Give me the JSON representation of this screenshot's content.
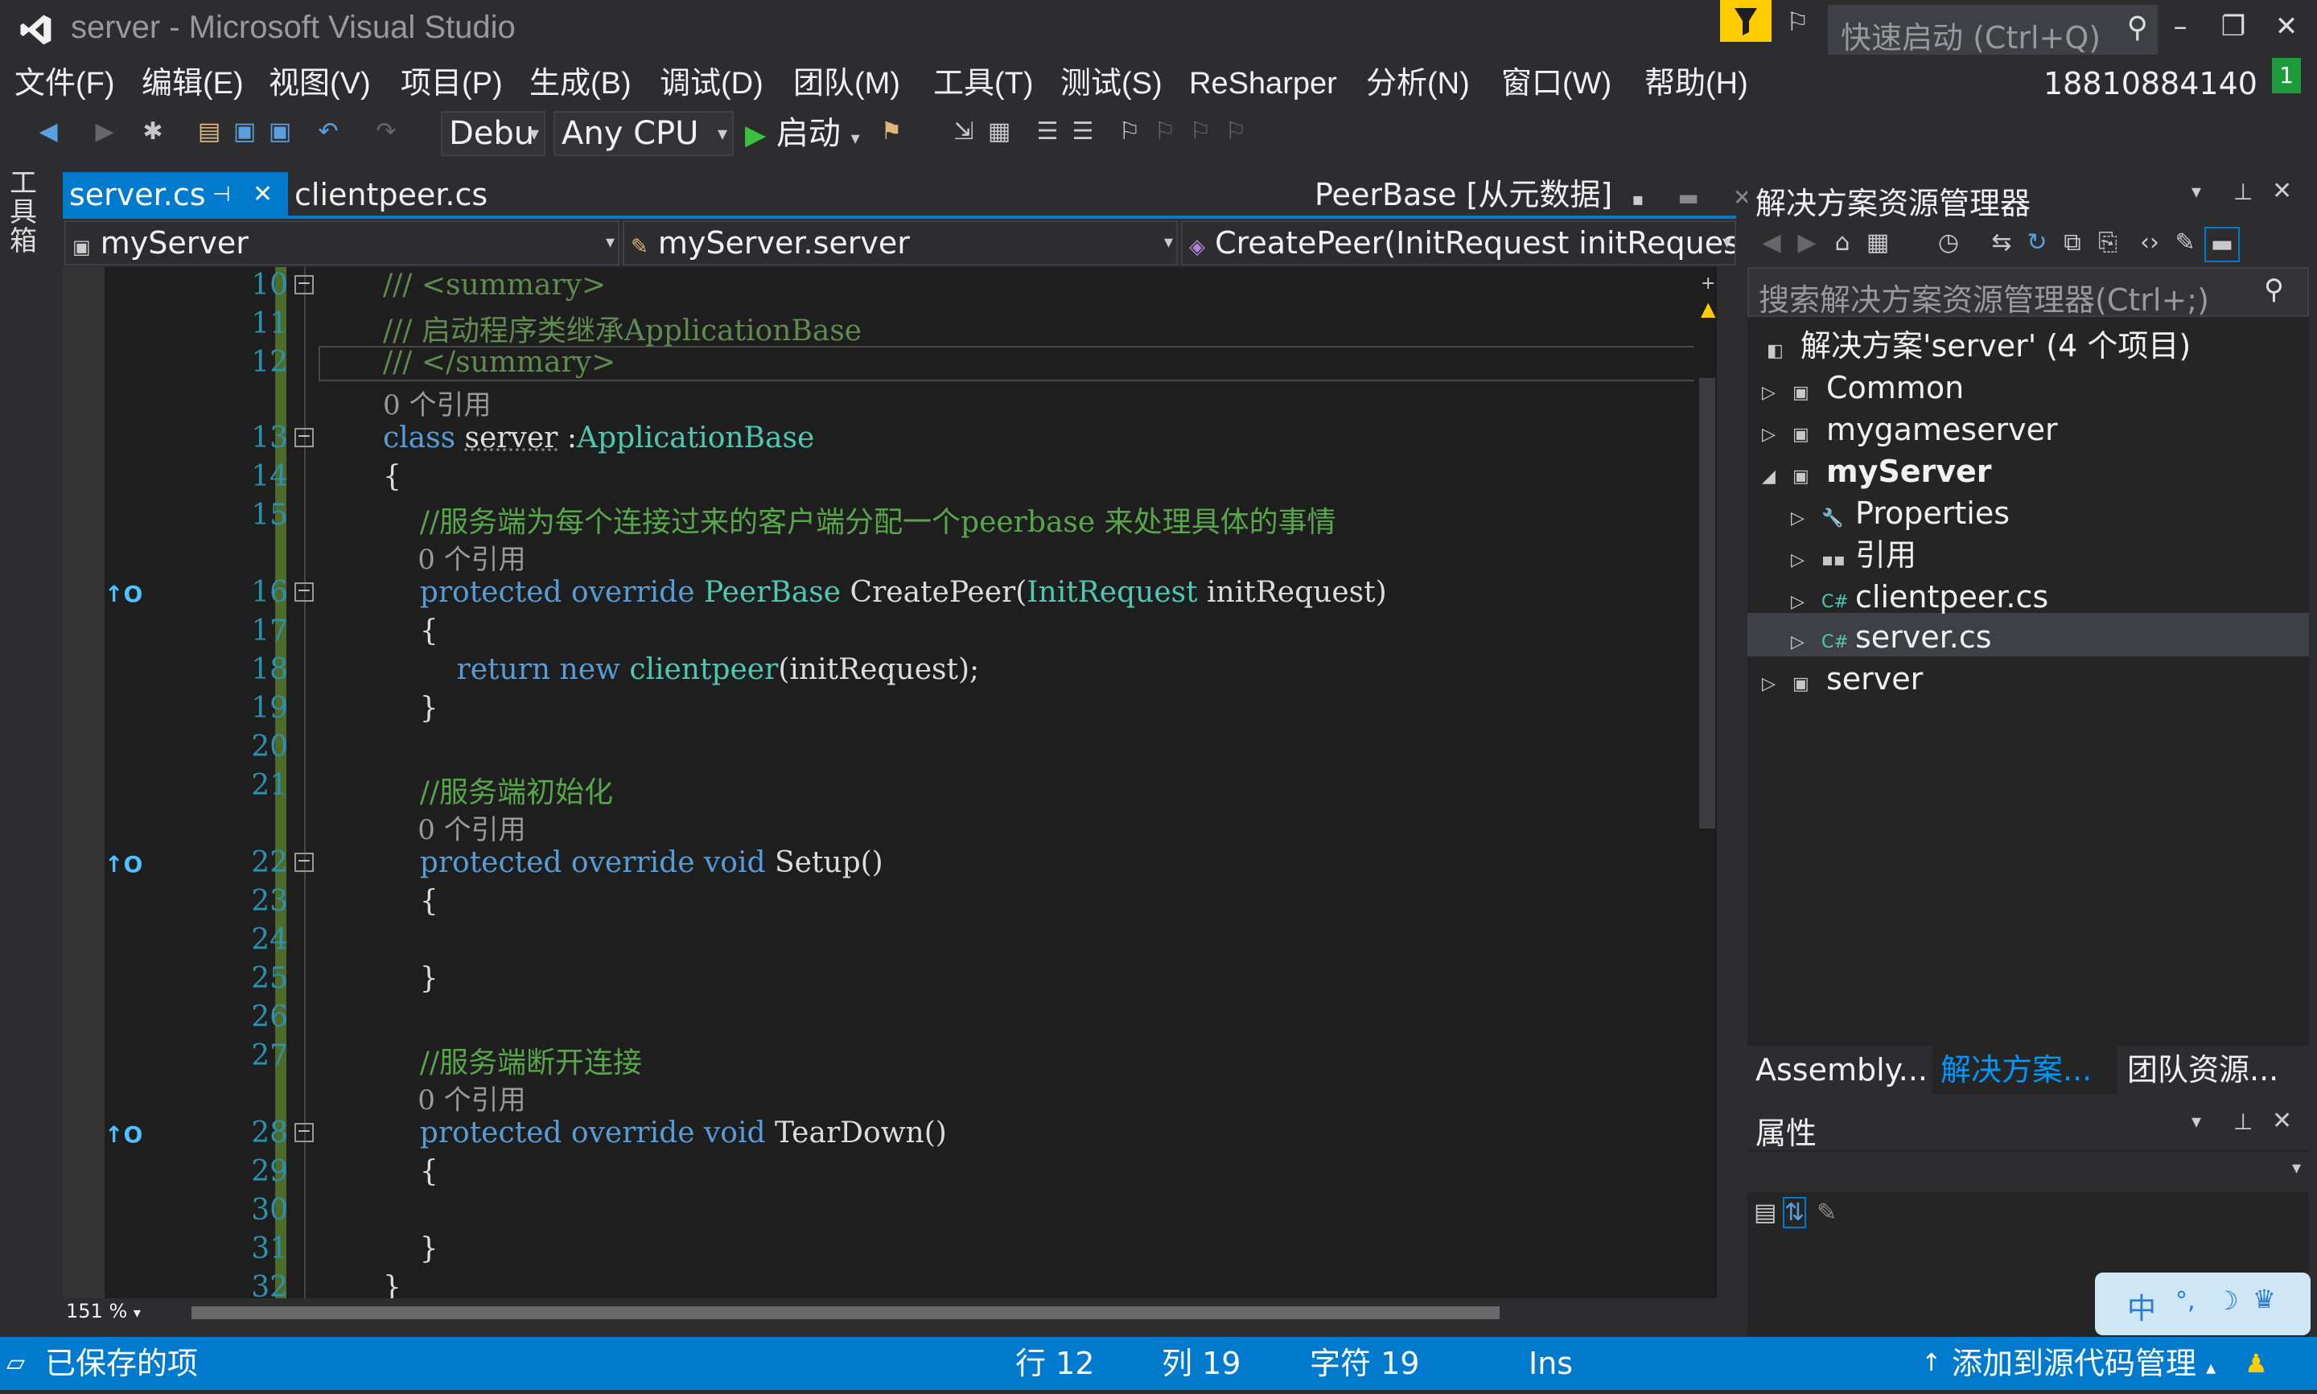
{
  "title_bar": {
    "title": "server - Microsoft Visual Studio",
    "quick_launch_placeholder": "快速启动 (Ctrl+Q)"
  },
  "menu": [
    "文件(F)",
    "编辑(E)",
    "视图(V)",
    "项目(P)",
    "生成(B)",
    "调试(D)",
    "团队(M)",
    "工具(T)",
    "测试(S)",
    "ReSharper",
    "分析(N)",
    "窗口(W)",
    "帮助(H)"
  ],
  "account": "18810884140",
  "notification_count": "1",
  "toolbar": {
    "config": "Debu",
    "platform": "Any CPU",
    "start_label": "启动"
  },
  "toolbox_label": "工具箱",
  "tabs": {
    "active": "server.cs",
    "second": "clientpeer.cs",
    "preview": "PeerBase [从元数据]"
  },
  "navbar": {
    "project": "myServer",
    "class": "myServer.server",
    "member": "CreatePeer(InitRequest initRequest"
  },
  "code_lines": [
    {
      "n": "10",
      "t": "/// <summary>"
    },
    {
      "n": "11",
      "t": "/// 启动程序类继承ApplicationBase"
    },
    {
      "n": "12",
      "t": "/// </summary>"
    },
    {
      "ref": "0 个引用"
    },
    {
      "n": "13",
      "t": "class server :ApplicationBase"
    },
    {
      "n": "14",
      "t": "{"
    },
    {
      "n": "15",
      "t": "    //服务端为每个连接过来的客户端分配一个peerbase 来处理具体的事情"
    },
    {
      "ref": "    0 个引用"
    },
    {
      "n": "16",
      "t": "    protected override PeerBase CreatePeer(InitRequest initRequest)"
    },
    {
      "n": "17",
      "t": "    {"
    },
    {
      "n": "18",
      "t": "        return new clientpeer(initRequest);"
    },
    {
      "n": "19",
      "t": "    }"
    },
    {
      "n": "20",
      "t": ""
    },
    {
      "n": "21",
      "t": "    //服务端初始化"
    },
    {
      "ref": "    0 个引用"
    },
    {
      "n": "22",
      "t": "    protected override void Setup()"
    },
    {
      "n": "23",
      "t": "    {"
    },
    {
      "n": "24",
      "t": ""
    },
    {
      "n": "25",
      "t": "    }"
    },
    {
      "n": "26",
      "t": ""
    },
    {
      "n": "27",
      "t": "    //服务端断开连接"
    },
    {
      "ref": "    0 个引用"
    },
    {
      "n": "28",
      "t": "    protected override void TearDown()"
    },
    {
      "n": "29",
      "t": "    {"
    },
    {
      "n": "30",
      "t": ""
    },
    {
      "n": "31",
      "t": "    }"
    },
    {
      "n": "32",
      "t": "}"
    }
  ],
  "override_marker": "↑O",
  "zoom": "151 %",
  "solution_explorer": {
    "title": "解决方案资源管理器",
    "search_placeholder": "搜索解决方案资源管理器(Ctrl+;)",
    "items": [
      {
        "label": "解决方案'server' (4 个项目)"
      },
      {
        "label": "Common"
      },
      {
        "label": "mygameserver"
      },
      {
        "label": "myServer"
      },
      {
        "label": "Properties"
      },
      {
        "label": "引用"
      },
      {
        "label": "clientpeer.cs"
      },
      {
        "label": "server.cs"
      },
      {
        "label": "server"
      }
    ],
    "bottom_tabs": [
      "Assembly...",
      "解决方案...",
      "团队资源..."
    ]
  },
  "properties": {
    "title": "属性"
  },
  "ime": "中",
  "status": {
    "message": "已保存的项",
    "line": "行 12",
    "col": "列 19",
    "char": "字符 19",
    "mode": "Ins",
    "source_control": "添加到源代码管理"
  },
  "colors": {
    "accent": "#007acc",
    "keyword": "#569cd6",
    "type": "#4ec9b0",
    "comment": "#57a64a",
    "line_number": "#2b91af"
  }
}
